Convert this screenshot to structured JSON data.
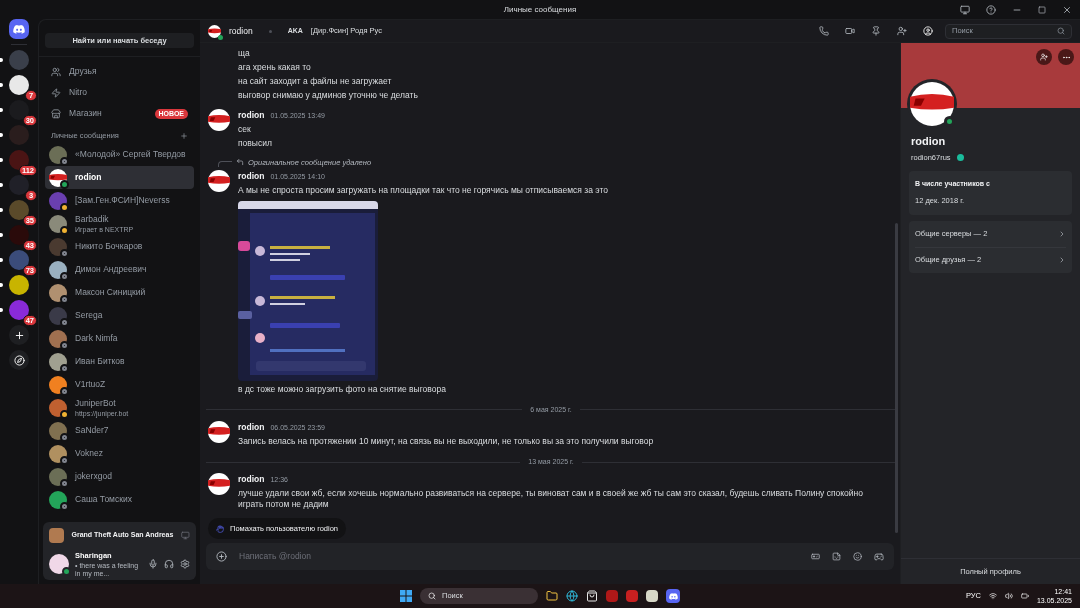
{
  "window": {
    "title": "Личные сообщения"
  },
  "servers": [
    {
      "unread": true
    },
    {
      "unread": true,
      "badge": "7"
    },
    {
      "unread": true,
      "badge": "30"
    },
    {
      "unread": true
    },
    {
      "unread": true,
      "badge": "112"
    },
    {
      "unread": true,
      "badge": "3"
    },
    {
      "unread": true,
      "badge": "35"
    },
    {
      "unread": true,
      "badge": "43"
    },
    {
      "unread": true,
      "badge": "73"
    },
    {
      "unread": true
    },
    {
      "unread": true,
      "badge": "47"
    }
  ],
  "sidebar": {
    "search": "Найти или начать беседу",
    "nav": [
      {
        "kind": "friends",
        "label": "Друзья"
      },
      {
        "kind": "nitro",
        "label": "Nitro"
      },
      {
        "kind": "shop",
        "label": "Магазин",
        "badge": "НОВОЕ"
      }
    ],
    "dm_header": "Личные сообщения",
    "dms": [
      {
        "name": "«Молодой» Сергей Твердов",
        "online": false,
        "idle": false,
        "selected": false
      },
      {
        "name": "rodion",
        "online": true,
        "idle": false,
        "selected": true
      },
      {
        "name": "[Зам.Ген.ФСИН]Neverss",
        "online": false,
        "idle": true,
        "selected": false
      },
      {
        "name": "Barbadik",
        "activity": "Играет в NEXTRP",
        "online": false,
        "idle": true,
        "selected": false
      },
      {
        "name": "Никито Бочкаров",
        "online": false,
        "idle": false,
        "selected": false
      },
      {
        "name": "Димон Андреевич",
        "online": false,
        "idle": false,
        "selected": false
      },
      {
        "name": "Максон Синицкий",
        "online": false,
        "idle": false,
        "selected": false
      },
      {
        "name": "Serega",
        "online": false,
        "idle": false,
        "selected": false
      },
      {
        "name": "Dark Nimfa",
        "online": false,
        "idle": false,
        "selected": false
      },
      {
        "name": "Иван Битков",
        "online": false,
        "idle": false,
        "selected": false
      },
      {
        "name": "V1rtuoZ",
        "online": false,
        "idle": false,
        "selected": false
      },
      {
        "name": "JuniperBot",
        "activity": "https://juniper.bot",
        "online": false,
        "idle": true,
        "selected": false
      },
      {
        "name": "SaNder7",
        "online": false,
        "idle": false,
        "selected": false
      },
      {
        "name": "Voknez",
        "online": false,
        "idle": false,
        "selected": false
      },
      {
        "name": "jokerxgod",
        "online": false,
        "idle": false,
        "selected": false
      },
      {
        "name": "Саша Томских",
        "online": false,
        "idle": false,
        "selected": false
      }
    ],
    "now_playing": "Grand Theft Auto San Andreas",
    "user": {
      "name": "Sharingan",
      "status_text": "• there was a feeling in my me..."
    }
  },
  "chat": {
    "user": "rodion",
    "aka_label": "AKA",
    "aka": "[Дир.Фсин] Родя Рус",
    "search_placeholder": "Поиск",
    "messages": [
      {
        "kind": "continuation",
        "lines": [
          "ща",
          "ага хрень какая то",
          "на сайт заходит а файлы не загружает",
          "выговор снимаю у админов уточню че делать"
        ]
      },
      {
        "kind": "message",
        "author": "rodion",
        "time": "01.05.2025 13:49",
        "lines": [
          "сек",
          "повысил"
        ]
      },
      {
        "kind": "message",
        "author": "rodion",
        "time": "01.05.2025 14:10",
        "reply": "Оригинальное сообщение удалено",
        "lines": [
          "А мы не спроста просим загружать на площадки так что не горячись мы отписываемся за это"
        ],
        "attachment": {
          "kind": "picture"
        },
        "after": [
          "в дс тоже можно загрузить фото на снятие выговора"
        ]
      },
      {
        "kind": "divider",
        "label": "6 мая 2025 г."
      },
      {
        "kind": "message",
        "author": "rodion",
        "time": "06.05.2025 23:59",
        "lines": [
          "Запись велась на протяжении 10 минут, на связь вы не выходили, не только вы за это получили выговор"
        ]
      },
      {
        "kind": "divider",
        "label": "13 мая 2025 г."
      },
      {
        "kind": "message",
        "author": "rodion",
        "time": "12:36",
        "lines": [
          "лучше удали свои жб, если хочешь нормально развиваться на сервере, ты виноват сам и в своей же жб ты сам это сказал, будешь сливать Полину спокойно играть потом не дадим"
        ]
      }
    ],
    "wave": "Помахать пользователю rodion",
    "input_placeholder": "Написать @rodion"
  },
  "profile": {
    "name": "rodion",
    "username": "rodion67rus",
    "member_since_label": "В числе участников с",
    "member_since": "12 дек. 2018 г.",
    "links": [
      "Общие серверы — 2",
      "Общие друзья — 2"
    ],
    "footer": "Полный профиль"
  },
  "taskbar": {
    "search": "Поиск",
    "lang": "РУС",
    "time": "12:41",
    "date": "13.05.2025"
  }
}
